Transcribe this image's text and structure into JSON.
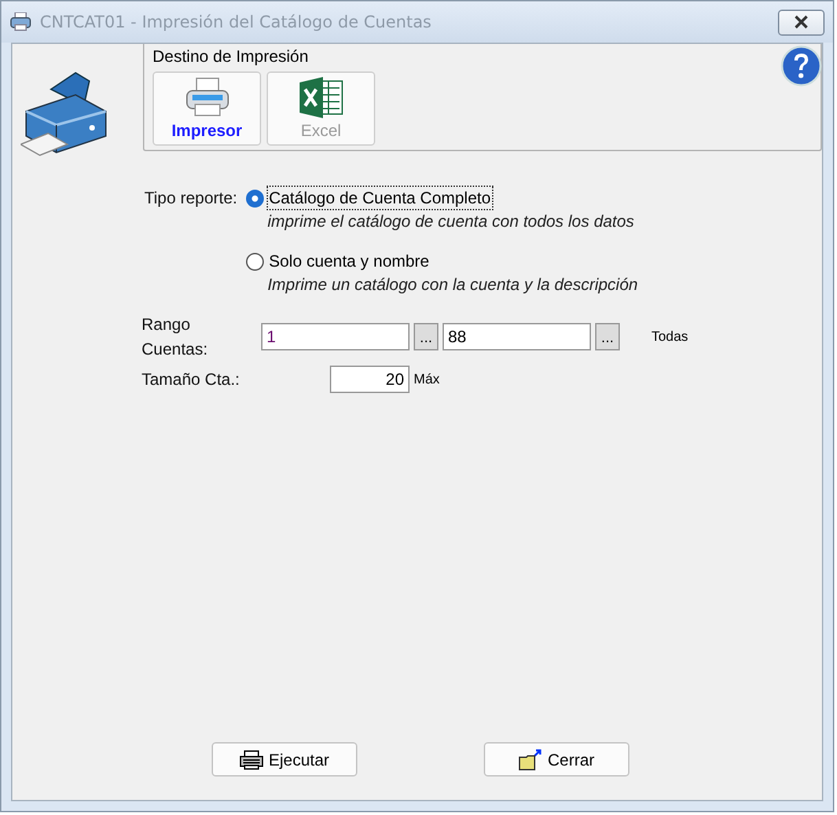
{
  "window": {
    "title": "CNTCAT01 - Impresión del Catálogo de Cuentas"
  },
  "destination": {
    "title": "Destino de Impresión",
    "options": [
      {
        "label": "Impresor",
        "kind": "printer",
        "selected": true
      },
      {
        "label": "Excel",
        "kind": "excel",
        "selected": false
      }
    ]
  },
  "report_type": {
    "label": "Tipo reporte:",
    "options": [
      {
        "label": "Catálogo de Cuenta Completo",
        "description": "imprime el catálogo de cuenta con todos los datos",
        "selected": true
      },
      {
        "label": "Solo cuenta y nombre",
        "description": "Imprime un catálogo con la cuenta y la descripción",
        "selected": false
      }
    ]
  },
  "range": {
    "label": "Rango Cuentas:",
    "from": "1",
    "to": "88",
    "browse": "...",
    "all": "Todas"
  },
  "size": {
    "label": "Tamaño Cta.:",
    "value": "20",
    "hint": "Máx"
  },
  "buttons": [
    {
      "label": "Ejecutar",
      "kind": "run"
    },
    {
      "label": "Cerrar",
      "kind": "close"
    }
  ]
}
